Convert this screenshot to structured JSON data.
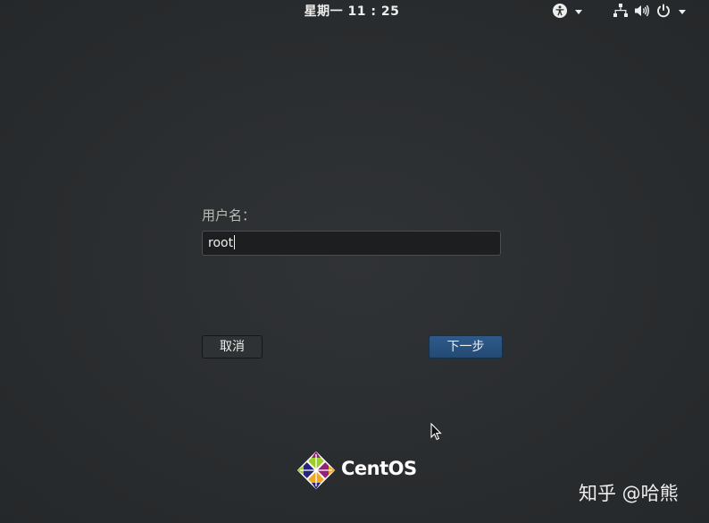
{
  "top_bar": {
    "clock": "星期一  11 : 25",
    "accessibility_icon": "accessibility-icon",
    "network_icon": "network-wired-icon",
    "volume_icon": "volume-icon",
    "power_icon": "power-icon"
  },
  "login": {
    "username_label": "用户名：",
    "username_value": "root",
    "cancel_label": "取消",
    "next_label": "下一步"
  },
  "branding": {
    "logo_icon": "centos-logo-icon",
    "logo_text": "CentOS"
  },
  "watermark": {
    "text": "知乎 @哈熊"
  },
  "colors": {
    "background": "#2b2e30",
    "primary_button": "#2e5a8a",
    "text": "#eeeeec",
    "label_text": "#babdb6"
  }
}
